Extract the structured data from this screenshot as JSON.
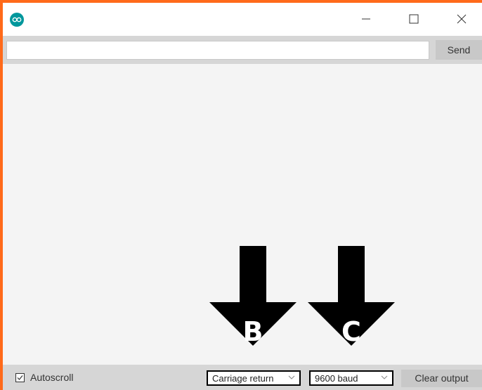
{
  "window": {
    "min_icon": "minimize-icon",
    "max_icon": "maximize-icon",
    "close_icon": "close-icon",
    "app_icon": "arduino-logo-icon"
  },
  "send_bar": {
    "input_value": "",
    "send_label": "Send"
  },
  "bottom_bar": {
    "autoscroll_label": "Autoscroll",
    "autoscroll_checked": true,
    "line_ending": "Carriage return",
    "baud_rate": "9600 baud",
    "clear_label": "Clear output"
  },
  "annotations": {
    "arrow_b_label": "B",
    "arrow_c_label": "C"
  },
  "colors": {
    "accent_orange": "#ff6a1a",
    "arduino_teal": "#00979c"
  }
}
